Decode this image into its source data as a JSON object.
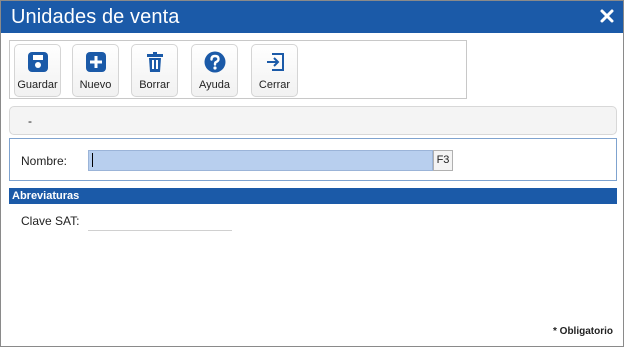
{
  "window": {
    "title": "Unidades de venta"
  },
  "toolbar": {
    "buttons": [
      {
        "label": "Guardar",
        "icon": "save-icon"
      },
      {
        "label": "Nuevo",
        "icon": "plus-icon"
      },
      {
        "label": "Borrar",
        "icon": "trash-icon"
      },
      {
        "label": "Ayuda",
        "icon": "help-icon"
      },
      {
        "label": "Cerrar",
        "icon": "exit-icon"
      }
    ]
  },
  "info": {
    "text": "-"
  },
  "form": {
    "nombre_label": "Nombre:",
    "nombre_value": "",
    "f3_label": "F3"
  },
  "section": {
    "title": "Abreviaturas",
    "clave_label": "Clave SAT:",
    "clave_value": ""
  },
  "footer": {
    "required_note": "* Obligatorio"
  },
  "colors": {
    "accent": "#1b5aa8",
    "input_highlight": "#b8cfee"
  }
}
